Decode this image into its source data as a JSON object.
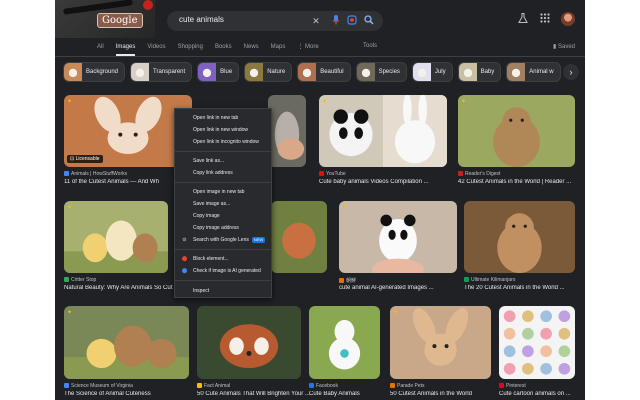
{
  "header": {
    "logo": "Google",
    "query": "cute animals",
    "icons": {
      "clear": "close-icon",
      "voice": "mic-icon",
      "lens": "lens-icon",
      "search": "search-icon",
      "labs": "flask-icon",
      "apps": "apps-grid-icon"
    }
  },
  "tabs": [
    {
      "label": "All",
      "active": false
    },
    {
      "label": "Images",
      "active": true
    },
    {
      "label": "Videos",
      "active": false
    },
    {
      "label": "Shopping",
      "active": false
    },
    {
      "label": "Books",
      "active": false
    },
    {
      "label": "News",
      "active": false
    },
    {
      "label": "Maps",
      "active": false
    },
    {
      "label": "⋮ More",
      "active": false
    }
  ],
  "tools_label": "Tools",
  "saved_label": "Saved",
  "chips": [
    {
      "label": "Background",
      "color": "#c98a5a"
    },
    {
      "label": "Transparent",
      "color": "#d8d0c8"
    },
    {
      "label": "Blue",
      "color": "#8060c0"
    },
    {
      "label": "Nature",
      "color": "#8a7a40"
    },
    {
      "label": "Beautiful",
      "color": "#b07050"
    },
    {
      "label": "Species",
      "color": "#706858"
    },
    {
      "label": "July",
      "color": "#e0e0f0"
    },
    {
      "label": "Baby",
      "color": "#c8c0a0"
    },
    {
      "label": "Animal w",
      "color": "#a08060"
    }
  ],
  "results": [
    {
      "source": "Animals | HowStuffWorks",
      "title": "11 of the Cutest Animals — And Wh",
      "licensed": "Licensable",
      "fav": "#4285f4",
      "bg": "#c47a48",
      "fg": "#f0dcc8"
    },
    {
      "source": "",
      "title": "",
      "fav": "#ea4335",
      "bg": "#6a6a60",
      "fg": "#b8b0a8"
    },
    {
      "source": "YouTube",
      "title": "Cute baby animals Videos Compilation ...",
      "fav": "#ff0000",
      "bg": "#d0c8b8",
      "fg": "#f8f8f8"
    },
    {
      "source": "Reader's Digest",
      "title": "42 Cutest Animals in the World | Reader ...",
      "fav": "#c5221f",
      "bg": "#9aa860",
      "fg": "#b08858"
    },
    {
      "source": "Critter Stop",
      "title": "Natural Beauty: Why Are Animals So Cut",
      "fav": "#34a853",
      "bg": "#a8b070",
      "fg": "#f4e6c0"
    },
    {
      "source": "",
      "title": "",
      "fav": "#fbbc04",
      "bg": "#708040",
      "fg": "#c87040"
    },
    {
      "source": "朝鮮",
      "title": "cute animal AI-generated Images ...",
      "fav": "#e37400",
      "bg": "#c8b8a8",
      "fg": "#f0f0f0"
    },
    {
      "source": "Ultimate Kilimanjaro",
      "title": "The 20 Cutest Animals in the World ...",
      "fav": "#0f9d58",
      "bg": "#7a5a38",
      "fg": "#c09060"
    },
    {
      "source": "Science Museum of Virginia",
      "title": "The Science of Animal Cuteness",
      "fav": "#4285f4",
      "bg": "#7a8858",
      "fg": "#b08050"
    },
    {
      "source": "Fact Animal",
      "title": "50 Cute Animals That Will Brighten Your ...",
      "fav": "#fbbc04",
      "bg": "#3a4a30",
      "fg": "#b85a30"
    },
    {
      "source": "Facebook",
      "title": "Cute Baby Animals",
      "fav": "#1877f2",
      "bg": "#8aa850",
      "fg": "#f8f8f8"
    },
    {
      "source": "Parade Pets",
      "title": "50 Cutest Animals in the World",
      "fav": "#e37400",
      "bg": "#c8a888",
      "fg": "#e0b890"
    },
    {
      "source": "Pinterest",
      "title": "Cute cartoon animals on ...",
      "fav": "#e60023",
      "bg": "#f4f4f4",
      "fg": "#c8a8d0"
    }
  ],
  "context_menu": {
    "items": [
      "Open link in new tab",
      "Open link in new window",
      "Open link in incognito window",
      "Save link as...",
      "Copy link address",
      "Open image in new tab",
      "Save image as...",
      "Copy image",
      "Copy image address",
      "Search with Google Lens",
      "Block element...",
      "Check if image is AI generated",
      "Inspect"
    ],
    "new_badge": "NEW"
  }
}
